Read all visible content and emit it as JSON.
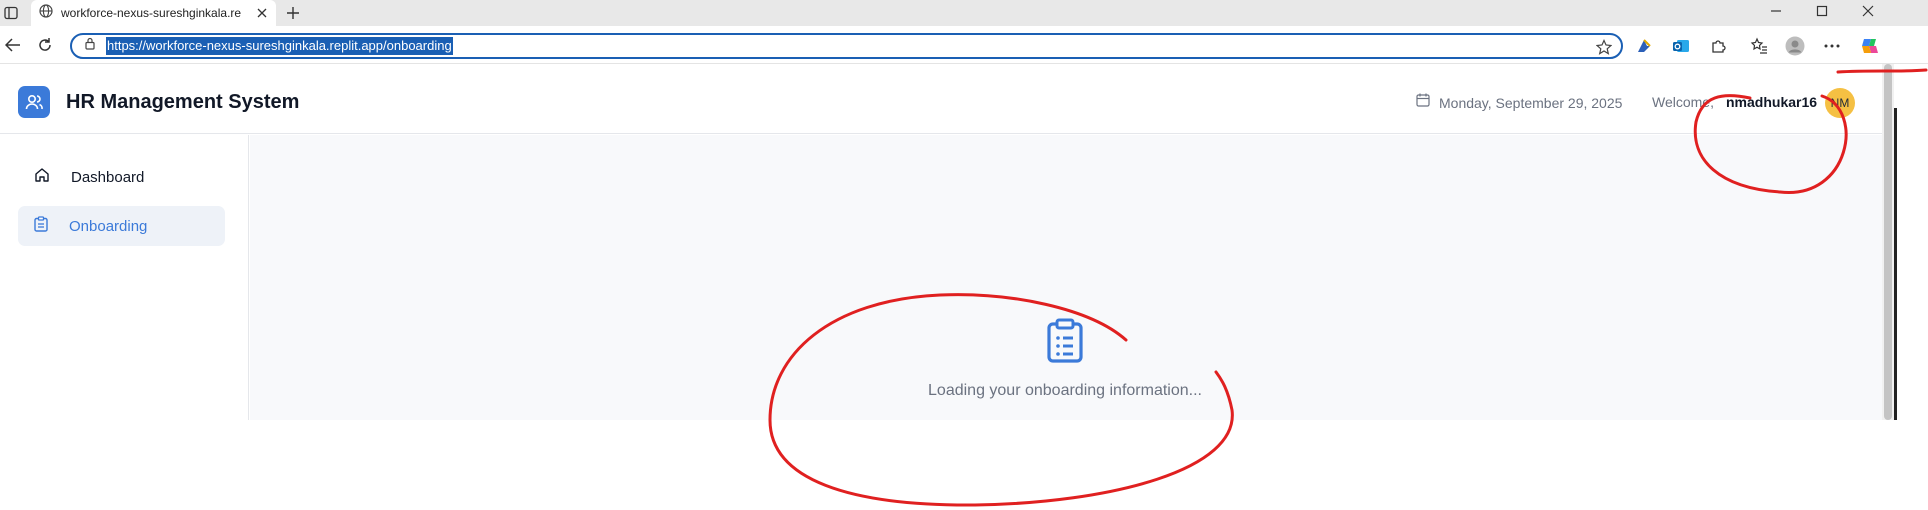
{
  "browser": {
    "tab_title": "workforce-nexus-sureshginkala.re",
    "url": "https://workforce-nexus-sureshginkala.replit.app/onboarding"
  },
  "header": {
    "title": "HR Management System",
    "date": "Monday, September 29, 2025",
    "welcome_label": "Welcome,",
    "username": "nmadhukar16",
    "avatar_initials": "NM"
  },
  "sidebar": {
    "items": [
      {
        "label": "Dashboard",
        "icon": "home-icon",
        "active": false
      },
      {
        "label": "Onboarding",
        "icon": "clipboard-icon",
        "active": true
      }
    ]
  },
  "main": {
    "loading_text": "Loading your onboarding information...",
    "icon": "clipboard-list-icon"
  },
  "colors": {
    "accent": "#3b7ad9",
    "avatar_bg": "#f5c043",
    "annotation": "#e02020",
    "url_highlight": "#1a5fb4"
  }
}
